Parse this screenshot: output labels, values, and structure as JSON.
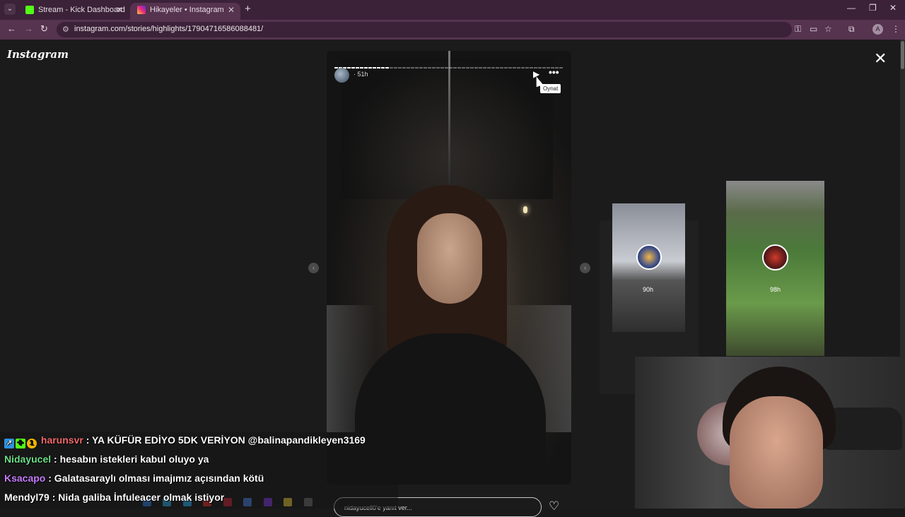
{
  "browser": {
    "tabs": [
      {
        "label": "Stream - Kick Dashboard",
        "favicon_color": "#53fc18"
      },
      {
        "label": "Hikayeler • Instagram",
        "favicon_color": "#e1306c"
      }
    ],
    "new_tab": "+",
    "url": "instagram.com/stories/highlights/17904716586088481/",
    "profile_initial": "A",
    "theme_color": "#56334f"
  },
  "instagram": {
    "logo": "Instagram",
    "story": {
      "time": "51h",
      "tooltip": "Oynat",
      "reply_placeholder": "nidayucell0'e yanıt ver..."
    },
    "previews": [
      {
        "label": "90h"
      },
      {
        "label": "98h"
      }
    ]
  },
  "chat": [
    {
      "user": "harunsvr",
      "message": ": YA KÜFÜR EDİYO 5DK VERİYON @balinapandikleyen3169",
      "user_color": "#f36b6b",
      "badges": [
        "verified-badge",
        "plus-badge",
        "one-badge"
      ]
    },
    {
      "user": "Nidayucel",
      "message": ": hesabın istekleri kabul oluyo ya",
      "user_color": "#6fe08a",
      "badges": []
    },
    {
      "user": "Ksacapo",
      "message": ": Galatasaraylı olması imajımız açısından kötü",
      "user_color": "#c77dff",
      "badges": []
    },
    {
      "user": "Mendyl79",
      "message": ": Nida galiba İnfuleacer olmak istiyor",
      "user_color": "#ffffff",
      "badges": []
    }
  ]
}
